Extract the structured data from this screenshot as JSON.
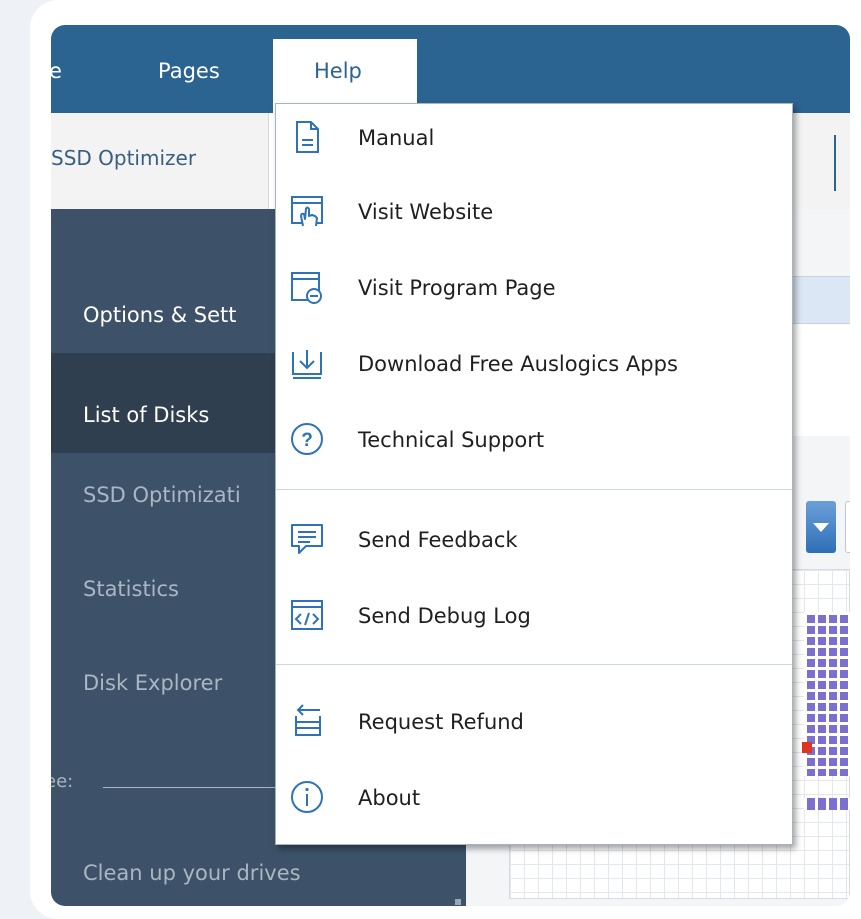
{
  "menubar": {
    "items": [
      {
        "label": "e"
      },
      {
        "label": "Pages"
      },
      {
        "label": "Help"
      }
    ]
  },
  "tabs": {
    "active_label": "SSD Optimizer"
  },
  "sidebar": {
    "items": [
      {
        "label": "Options & Sett"
      },
      {
        "label": "List of Disks"
      },
      {
        "label": "SSD Optimizati"
      },
      {
        "label": "Statistics"
      },
      {
        "label": "Disk Explorer"
      }
    ],
    "free_label": "ee:",
    "footer_label": "Clean up your drives"
  },
  "help_menu": {
    "items": [
      {
        "label": "Manual",
        "icon": "document-icon"
      },
      {
        "label": "Visit Website",
        "icon": "hand-pointer-icon"
      },
      {
        "label": "Visit Program Page",
        "icon": "program-page-icon"
      },
      {
        "label": "Download Free Auslogics Apps",
        "icon": "download-icon"
      },
      {
        "label": "Technical Support",
        "icon": "question-circle-icon"
      },
      {
        "label": "Send Feedback",
        "icon": "feedback-icon"
      },
      {
        "label": "Send Debug Log",
        "icon": "code-window-icon"
      },
      {
        "label": "Request Refund",
        "icon": "refund-icon"
      },
      {
        "label": "About",
        "icon": "info-circle-icon"
      }
    ]
  },
  "colors": {
    "menubar": "#2b6391",
    "sidebar": "#3d5268",
    "sidebar_active": "#2f3f50",
    "icon_blue": "#2e73b8",
    "disk_used": "#7b6fd0",
    "disk_fragmented": "#e0341f"
  }
}
